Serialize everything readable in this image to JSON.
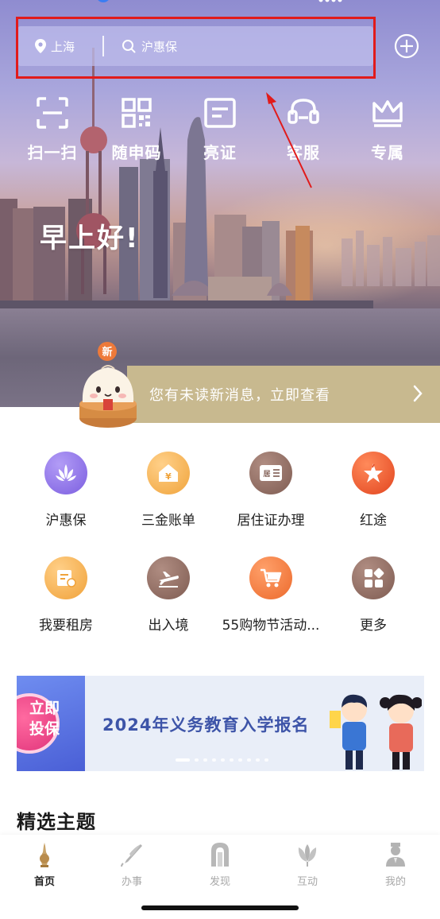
{
  "header": {
    "location": "上海",
    "search_placeholder": "沪惠保"
  },
  "quick_actions": [
    {
      "label": "扫一扫",
      "icon": "scan-icon"
    },
    {
      "label": "随申码",
      "icon": "qr-code-icon"
    },
    {
      "label": "亮证",
      "icon": "certificate-icon"
    },
    {
      "label": "客服",
      "icon": "customer-service-icon"
    },
    {
      "label": "专属",
      "icon": "crown-icon"
    }
  ],
  "greeting": "早上好!",
  "notice": {
    "badge": "新",
    "text": "您有未读新消息，立即查看"
  },
  "services": [
    {
      "label": "沪惠保",
      "icon": "lotus-icon",
      "color": "#8a6fe0"
    },
    {
      "label": "三金账单",
      "icon": "money-house-icon",
      "color": "#f0b24e"
    },
    {
      "label": "居住证办理",
      "icon": "residence-card-icon",
      "color": "#8e6a5f"
    },
    {
      "label": "红途",
      "icon": "red-star-icon",
      "color": "#e8512c"
    },
    {
      "label": "我要租房",
      "icon": "rent-house-icon",
      "color": "#f2ad43"
    },
    {
      "label": "出入境",
      "icon": "airplane-icon",
      "color": "#8e6a5f"
    },
    {
      "label": "55购物节活动...",
      "icon": "shopping-cart-icon",
      "color": "#f07a3b"
    },
    {
      "label": "更多",
      "icon": "more-grid-icon",
      "color": "#8e6a5f"
    }
  ],
  "banner": {
    "side_text": "立即\n投保",
    "title": "2024年义务教育入学报名"
  },
  "section_title": "精选主题",
  "tabs": [
    {
      "label": "首页",
      "icon": "home-icon",
      "active": true
    },
    {
      "label": "办事",
      "icon": "pen-icon",
      "active": false
    },
    {
      "label": "发现",
      "icon": "discover-gate-icon",
      "active": false
    },
    {
      "label": "互动",
      "icon": "magnolia-icon",
      "active": false
    },
    {
      "label": "我的",
      "icon": "person-icon",
      "active": false
    }
  ]
}
